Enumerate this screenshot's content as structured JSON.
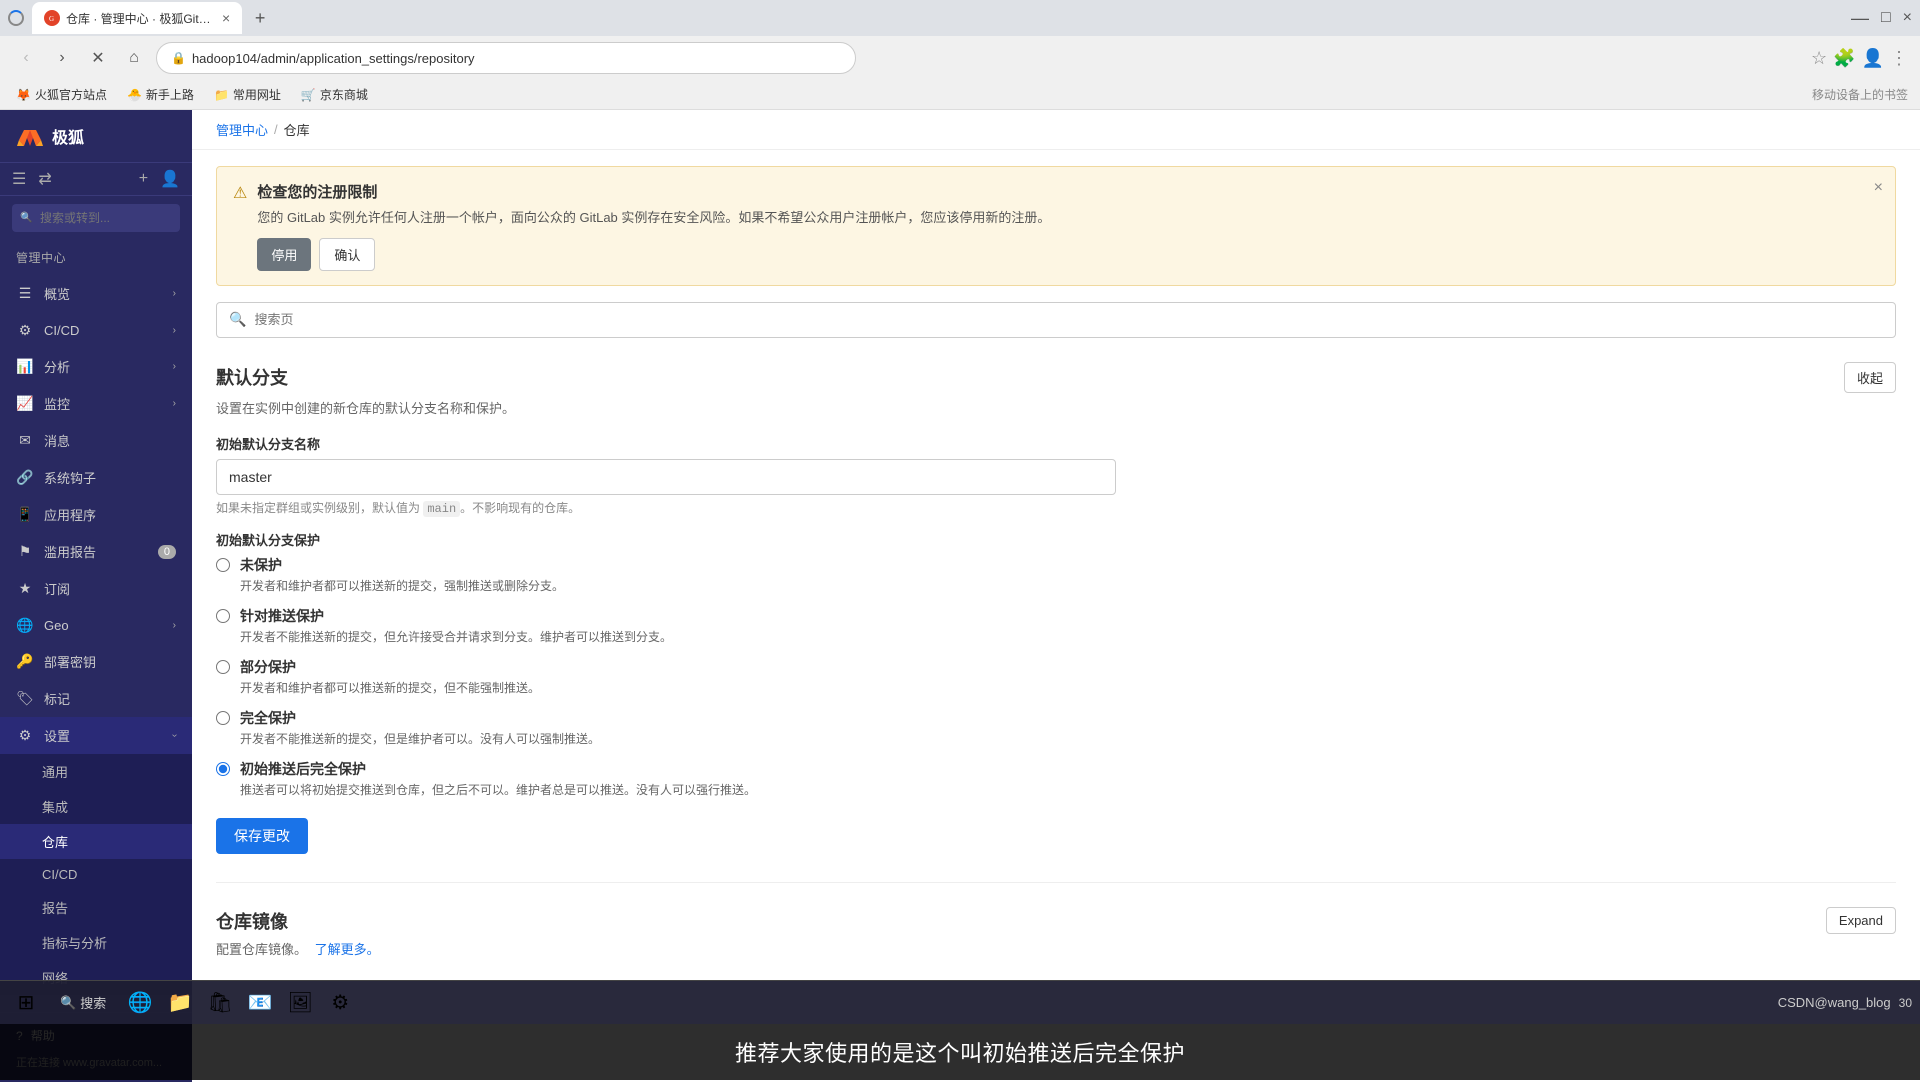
{
  "browser": {
    "tab_label": "仓库 · 管理中心 · 极狐GitLab",
    "url": "hadoop104/admin/application_settings/repository",
    "favicon_text": "G",
    "new_tab_icon": "+",
    "back_disabled": false,
    "forward_icon": "›",
    "refresh_icon": "↻",
    "home_icon": "⌂"
  },
  "bookmarks": [
    {
      "label": "火狐官方站点"
    },
    {
      "label": "新手上路"
    },
    {
      "label": "常用网址"
    },
    {
      "label": "京东商城"
    }
  ],
  "sidebar": {
    "logo_text": "极狐",
    "search_placeholder": "搜索或转到...",
    "items": [
      {
        "label": "管理中心",
        "icon": "⊞",
        "arrow": false,
        "section": true
      },
      {
        "label": "概览",
        "icon": "☰",
        "arrow": true
      },
      {
        "label": "CI/CD",
        "icon": "⚙",
        "arrow": true
      },
      {
        "label": "分析",
        "icon": "📊",
        "arrow": true
      },
      {
        "label": "监控",
        "icon": "📈",
        "arrow": true
      },
      {
        "label": "消息",
        "icon": "✉",
        "arrow": false
      },
      {
        "label": "系统钩子",
        "icon": "🔗",
        "arrow": false
      },
      {
        "label": "应用程序",
        "icon": "📱",
        "arrow": false
      },
      {
        "label": "滥用报告",
        "icon": "⚑",
        "arrow": false,
        "badge": "0"
      },
      {
        "label": "订阅",
        "icon": "★",
        "arrow": false
      },
      {
        "label": "Geo",
        "icon": "🌐",
        "arrow": true
      },
      {
        "label": "部署密钥",
        "icon": "🔑",
        "arrow": false
      },
      {
        "label": "标记",
        "icon": "🏷",
        "arrow": false
      },
      {
        "label": "设置",
        "icon": "⚙",
        "arrow": true,
        "expanded": true
      }
    ],
    "sub_items": [
      {
        "label": "通用",
        "active": false
      },
      {
        "label": "集成",
        "active": false
      },
      {
        "label": "仓库",
        "active": true
      },
      {
        "label": "CI/CD",
        "active": false
      },
      {
        "label": "报告",
        "active": false
      },
      {
        "label": "指标与分析",
        "active": false
      },
      {
        "label": "网络",
        "active": false
      }
    ],
    "help_label": "帮助",
    "status_text": "正在连接 www.gravatar.com..."
  },
  "breadcrumb": {
    "items": [
      "管理中心",
      "仓库"
    ],
    "separator": "/"
  },
  "alert": {
    "title": "检查您的注册限制",
    "description": "您的 GitLab 实例允许任何人注册一个帐户，面向公众的 GitLab 实例存在安全风险。如果不希望公众用户注册帐户，您应该停用新的注册。",
    "btn_disable": "停用",
    "btn_confirm": "确认",
    "close_icon": "×"
  },
  "search": {
    "placeholder": "搜索页"
  },
  "default_branch": {
    "title": "默认分支",
    "description": "设置在实例中创建的新仓库的默认分支名称和保护。",
    "collapse_label": "收起",
    "branch_name_label": "初始默认分支名称",
    "branch_name_value": "master",
    "branch_hint": "如果未指定群组或实例级别，默认值为 main。不影响现有的仓库。",
    "protection_label": "初始默认分支保护",
    "protection_options": [
      {
        "id": "unprotected",
        "label": "未保护",
        "desc": "开发者和维护者都可以推送新的提交，强制推送或删除分支。",
        "checked": false
      },
      {
        "id": "push_protected",
        "label": "针对推送保护",
        "desc": "开发者不能推送新的提交，但允许接受合并请求到分支。维护者可以推送到分支。",
        "checked": false
      },
      {
        "id": "partial",
        "label": "部分保护",
        "desc": "开发者和维护者都可以推送新的提交，但不能强制推送。",
        "checked": false
      },
      {
        "id": "full",
        "label": "完全保护",
        "desc": "开发者不能推送新的提交，但是维护者可以。没有人可以强制推送。",
        "checked": false
      },
      {
        "id": "initial_push_full",
        "label": "初始推送后完全保护",
        "desc": "推送者可以将初始提交推送到仓库，但之后不可以。维护者总是可以推送。没有人可以强行推送。",
        "checked": true
      }
    ],
    "save_label": "保存更改"
  },
  "mirror": {
    "title": "仓库镜像",
    "description": "配置仓库镜像。",
    "learn_more": "了解更多。",
    "expand_label": "Expand"
  },
  "tooltip": {
    "text": "推荐大家使用的是这个叫初始推送后完全保护"
  },
  "watermark": "CSDN@wang_blog"
}
